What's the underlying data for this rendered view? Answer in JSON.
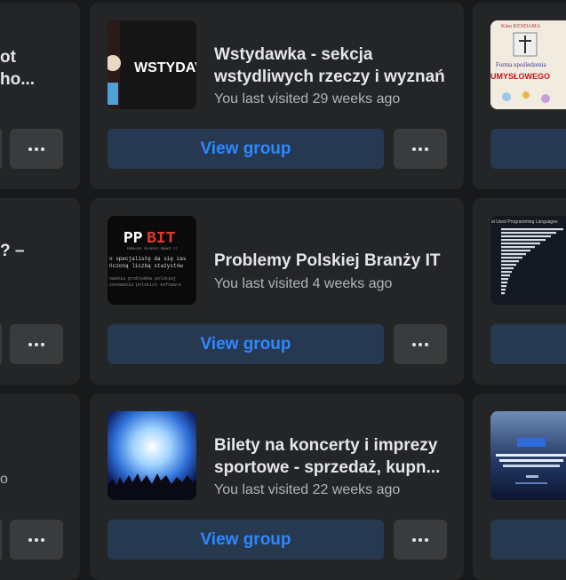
{
  "cards": [
    {
      "title": "Wstydawka - sekcja wstydliwych rzeczy i wyznań",
      "visited": "You last visited 29 weeks ago",
      "thumb_text": "WSTYDAV",
      "view_label": "View group",
      "more_icon": "more-horizontal-icon"
    },
    {
      "title": "Problemy Polskiej Branży IT",
      "visited": "You last visited 4 weeks ago",
      "thumb_text": "PPBIT",
      "thumb_sub": "PROBLEMY POLSKIEJ BRANŻY IT",
      "thumb_lines": [
        "o specjalistę da się zas",
        "ńczoną liczbą stażystów",
        "owania problemów polskiej",
        "zenowania polskich software"
      ],
      "view_label": "View group",
      "more_icon": "more-horizontal-icon"
    },
    {
      "title": "Bilety na koncerty i imprezy sportowe - sprzedaż, kupn...",
      "visited": "You last visited 22 weeks ago",
      "view_label": "View group",
      "more_icon": "more-horizontal-icon"
    }
  ],
  "left_partial": {
    "row1": [
      "ot",
      "ho..."
    ],
    "row2": [
      "? –"
    ],
    "row3_small": "o"
  },
  "right_partial": {
    "row1_thumb_top": "Kino KENDAMA",
    "row1_thumb_mid": "Forma upośledzenia",
    "row1_thumb_bottom": "UMYSŁOWEGO",
    "row2_thumb_top": "st Used Programming Languages"
  },
  "colors": {
    "page_bg": "#18191a",
    "card_bg": "#242526",
    "view_btn_bg": "#263951",
    "view_btn_text": "#2d88ff",
    "more_btn_bg": "#3a3b3c"
  }
}
